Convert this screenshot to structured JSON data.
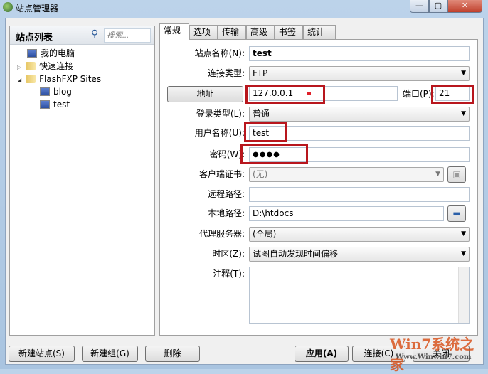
{
  "window": {
    "title": "站点管理器"
  },
  "left": {
    "header": "站点列表",
    "search_placeholder": "搜索...",
    "tree": [
      {
        "label": "我的电脑",
        "icon": "computer-icon"
      },
      {
        "label": "快速连接",
        "icon": "folder-icon"
      },
      {
        "label": "FlashFXP Sites",
        "icon": "folder-icon"
      },
      {
        "label": "blog",
        "icon": "monitor-icon"
      },
      {
        "label": "test",
        "icon": "monitor-icon"
      }
    ]
  },
  "tabs": [
    "常规",
    "选项",
    "传输",
    "高级",
    "书签",
    "统计"
  ],
  "form": {
    "site_name_label": "站点名称(N):",
    "site_name": "test",
    "conn_type_label": "连接类型:",
    "conn_type": "FTP",
    "address_button": "地址",
    "address": "127.0.0.1",
    "port_label": "端口(P):",
    "port": "21",
    "login_type_label": "登录类型(L):",
    "login_type": "普通",
    "username_label": "用户名称(U):",
    "username": "test",
    "password_label": "密码(W):",
    "password": "●●●●",
    "cert_label": "客户端证书:",
    "cert": "(无)",
    "remote_label": "远程路径:",
    "remote": "",
    "local_label": "本地路径:",
    "local": "D:\\htdocs",
    "proxy_label": "代理服务器:",
    "proxy": "(全局)",
    "tz_label": "时区(Z):",
    "tz": "试图自动发现时间偏移",
    "notes_label": "注释(T):",
    "notes": ""
  },
  "buttons": {
    "new_site": "新建站点(S)",
    "new_group": "新建组(G)",
    "delete": "删除",
    "apply": "应用(A)",
    "connect": "连接(C)",
    "close": "关闭"
  },
  "watermark": {
    "brand": "Win7系统之家",
    "url": "Www.Winwin7.com"
  }
}
